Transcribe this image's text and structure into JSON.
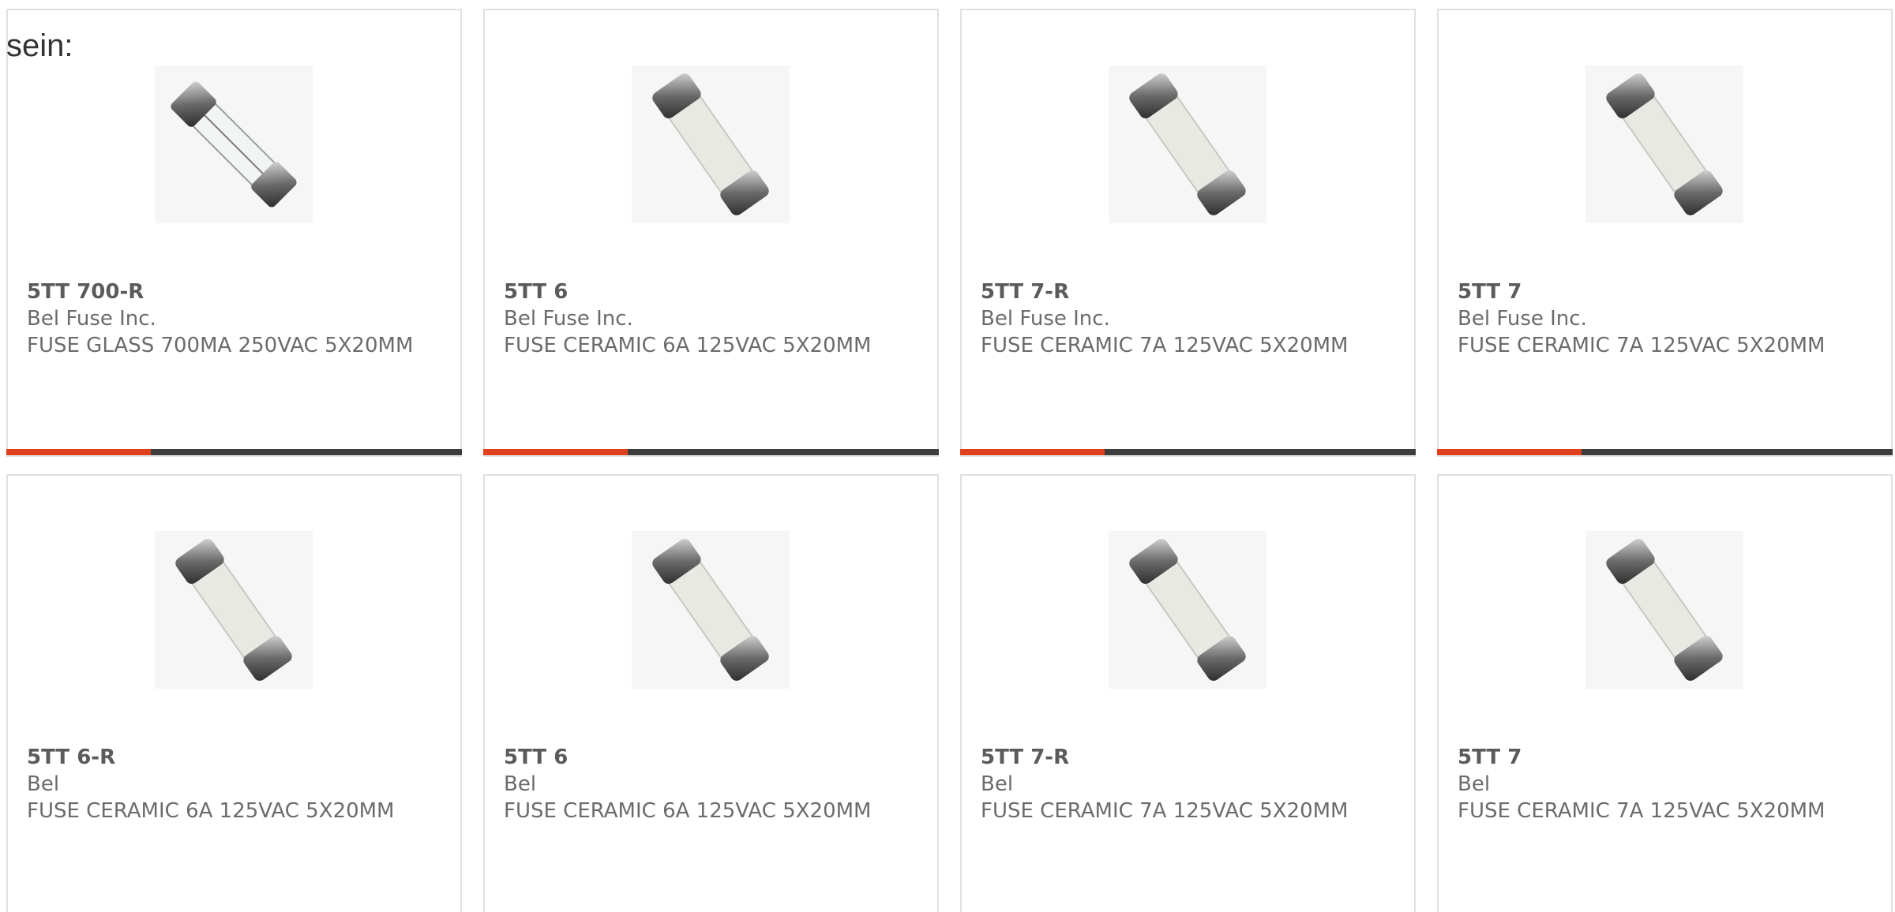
{
  "intro_text": "sein:",
  "colors": {
    "accent": "#e0401c",
    "bar_dark": "#3d3d3d",
    "text": "#6b6b6b"
  },
  "products": [
    {
      "part_number": "5TT 700-R",
      "manufacturer": "Bel Fuse Inc.",
      "description": "FUSE GLASS 700MA 250VAC 5X20MM",
      "image_icon": "glass-fuse-icon"
    },
    {
      "part_number": "5TT 6",
      "manufacturer": "Bel Fuse Inc.",
      "description": "FUSE CERAMIC 6A 125VAC 5X20MM",
      "image_icon": "ceramic-fuse-icon"
    },
    {
      "part_number": "5TT 7-R",
      "manufacturer": "Bel Fuse Inc.",
      "description": "FUSE CERAMIC 7A 125VAC 5X20MM",
      "image_icon": "ceramic-fuse-icon"
    },
    {
      "part_number": "5TT 7",
      "manufacturer": "Bel Fuse Inc.",
      "description": "FUSE CERAMIC 7A 125VAC 5X20MM",
      "image_icon": "ceramic-fuse-icon"
    },
    {
      "part_number": "5TT 6-R",
      "manufacturer": "Bel",
      "description": "FUSE CERAMIC 6A 125VAC 5X20MM",
      "image_icon": "ceramic-fuse-icon"
    },
    {
      "part_number": "5TT 6",
      "manufacturer": "Bel",
      "description": "FUSE CERAMIC 6A 125VAC 5X20MM",
      "image_icon": "ceramic-fuse-icon"
    },
    {
      "part_number": "5TT 7-R",
      "manufacturer": "Bel",
      "description": "FUSE CERAMIC 7A 125VAC 5X20MM",
      "image_icon": "ceramic-fuse-icon"
    },
    {
      "part_number": "5TT 7",
      "manufacturer": "Bel",
      "description": "FUSE CERAMIC 7A 125VAC 5X20MM",
      "image_icon": "ceramic-fuse-icon"
    }
  ]
}
